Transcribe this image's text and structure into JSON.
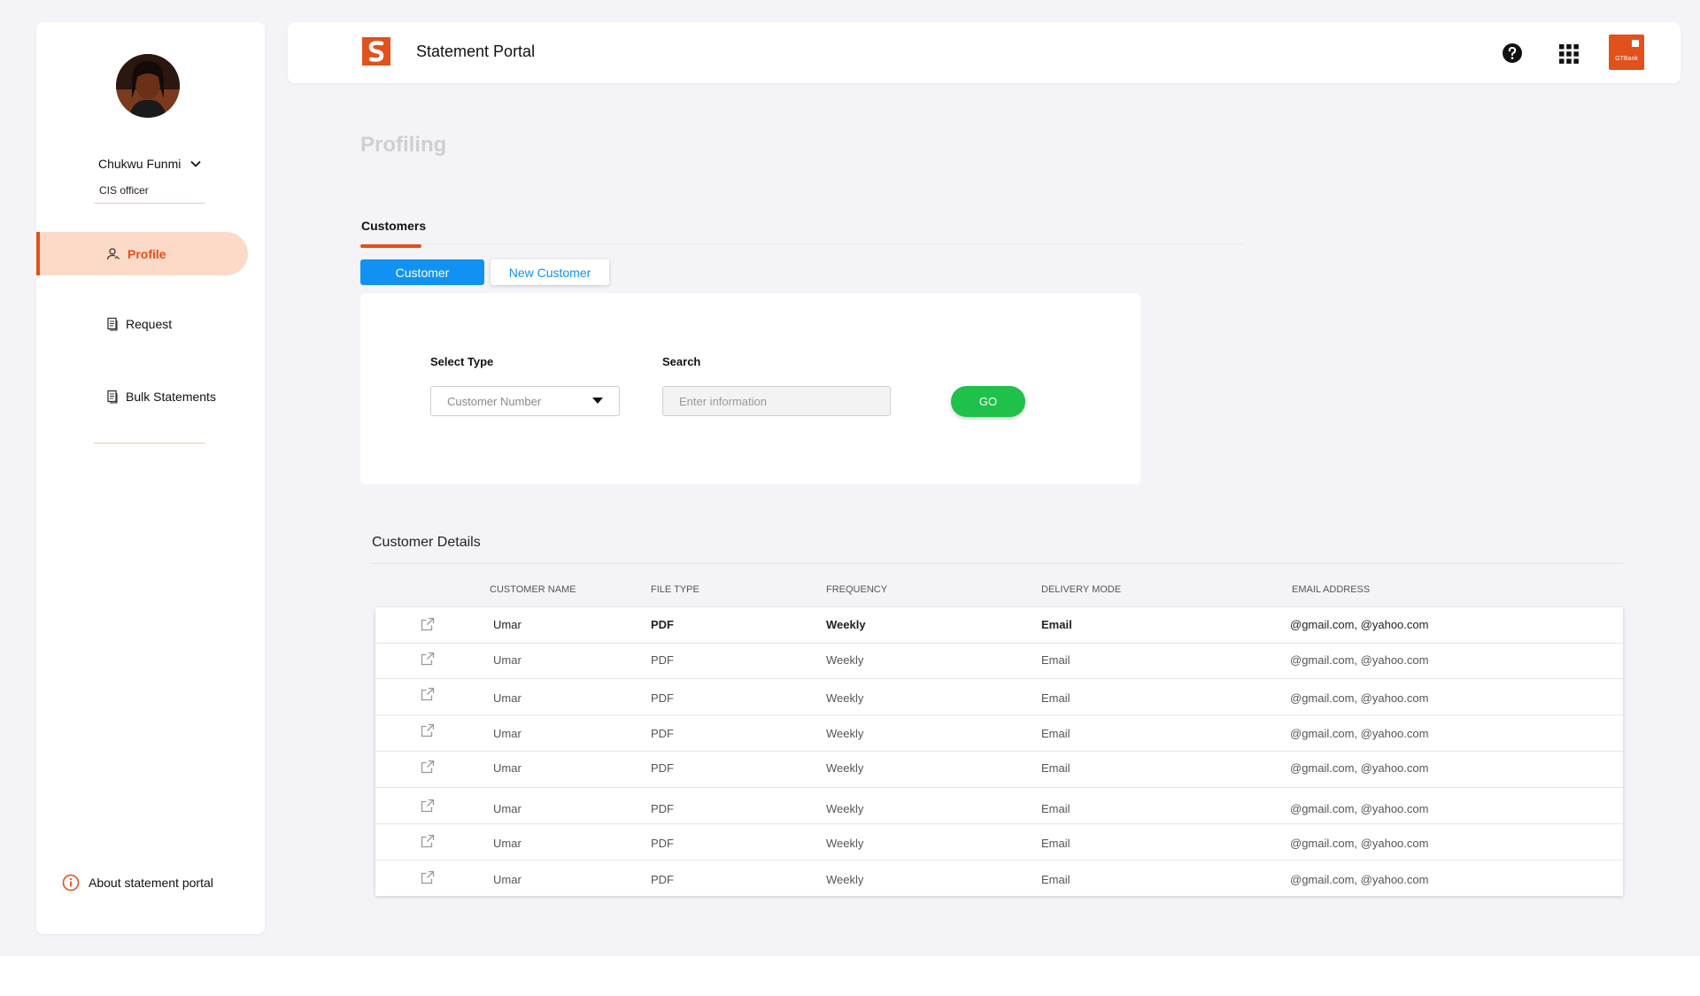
{
  "app": {
    "title": "Statement Portal",
    "brand_logo_text": "GTBank"
  },
  "user": {
    "name": "Chukwu Funmi",
    "role": "CIS officer"
  },
  "sidebar": {
    "items": [
      {
        "label": "Profile",
        "icon": "user-icon",
        "active": true
      },
      {
        "label": "Request",
        "icon": "document-icon",
        "active": false
      },
      {
        "label": "Bulk Statements",
        "icon": "document-icon",
        "active": false
      }
    ],
    "about_label": "About statement portal"
  },
  "page": {
    "title": "Profiling",
    "tab": "Customers",
    "segments": [
      "Customer",
      "New Customer"
    ]
  },
  "search": {
    "type_label": "Select Type",
    "type_value": "Customer Number",
    "search_label": "Search",
    "search_placeholder": "Enter information",
    "go_label": "GO"
  },
  "details": {
    "title": "Customer Details",
    "columns": [
      "CUSTOMER NAME",
      "FILE TYPE",
      "FREQUENCY",
      "DELIVERY MODE",
      "EMAIL ADDRESS"
    ],
    "rows": [
      {
        "name": "Umar",
        "file_type": "PDF",
        "frequency": "Weekly",
        "delivery": "Email",
        "email": "@gmail.com, @yahoo.com"
      },
      {
        "name": "Umar",
        "file_type": "PDF",
        "frequency": "Weekly",
        "delivery": "Email",
        "email": "@gmail.com, @yahoo.com"
      },
      {
        "name": "Umar",
        "file_type": "PDF",
        "frequency": "Weekly",
        "delivery": "Email",
        "email": "@gmail.com, @yahoo.com"
      },
      {
        "name": "Umar",
        "file_type": "PDF",
        "frequency": "Weekly",
        "delivery": "Email",
        "email": "@gmail.com, @yahoo.com"
      },
      {
        "name": "Umar",
        "file_type": "PDF",
        "frequency": "Weekly",
        "delivery": "Email",
        "email": "@gmail.com, @yahoo.com"
      },
      {
        "name": "Umar",
        "file_type": "PDF",
        "frequency": "Weekly",
        "delivery": "Email",
        "email": "@gmail.com, @yahoo.com"
      },
      {
        "name": "Umar",
        "file_type": "PDF",
        "frequency": "Weekly",
        "delivery": "Email",
        "email": "@gmail.com, @yahoo.com"
      },
      {
        "name": "Umar",
        "file_type": "PDF",
        "frequency": "Weekly",
        "delivery": "Email",
        "email": "@gmail.com, @yahoo.com"
      }
    ]
  },
  "colors": {
    "accent": "#e2501b",
    "primary_blue": "#1192f2",
    "go_green": "#1fc14a"
  }
}
